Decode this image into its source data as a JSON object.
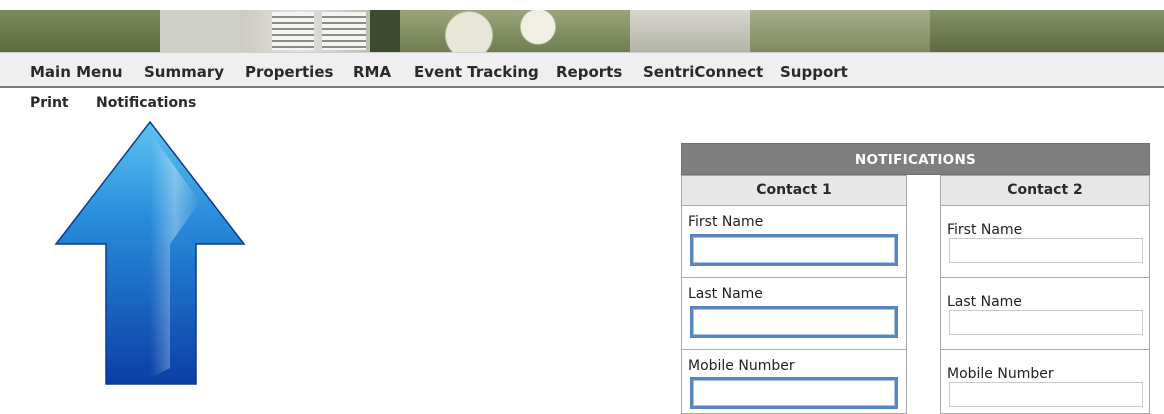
{
  "nav": {
    "main_menu": "Main Menu",
    "summary": "Summary",
    "properties": "Properties",
    "rma": "RMA",
    "event_tracking": "Event Tracking",
    "reports": "Reports",
    "sentriconnect": "SentriConnect",
    "support": "Support"
  },
  "subnav": {
    "print": "Print",
    "notifications": "Notifications"
  },
  "notifications": {
    "title": "NOTIFICATIONS",
    "contact1": {
      "heading": "Contact 1",
      "first_name_label": "First Name",
      "first_name_value": "",
      "last_name_label": "Last Name",
      "last_name_value": "",
      "mobile_label": "Mobile Number",
      "mobile_value": ""
    },
    "contact2": {
      "heading": "Contact 2",
      "first_name_label": "First Name",
      "first_name_value": "",
      "last_name_label": "Last Name",
      "last_name_value": "",
      "mobile_label": "Mobile Number",
      "mobile_value": ""
    }
  },
  "colors": {
    "nav_bg": "#efefef",
    "panel_header_bg": "#7f7f7f",
    "column_header_bg": "#e7e7e7",
    "focus_border": "#5a86bf",
    "arrow_blue": "#1f7ad0"
  },
  "icons": {
    "arrow": "up-arrow-icon"
  }
}
